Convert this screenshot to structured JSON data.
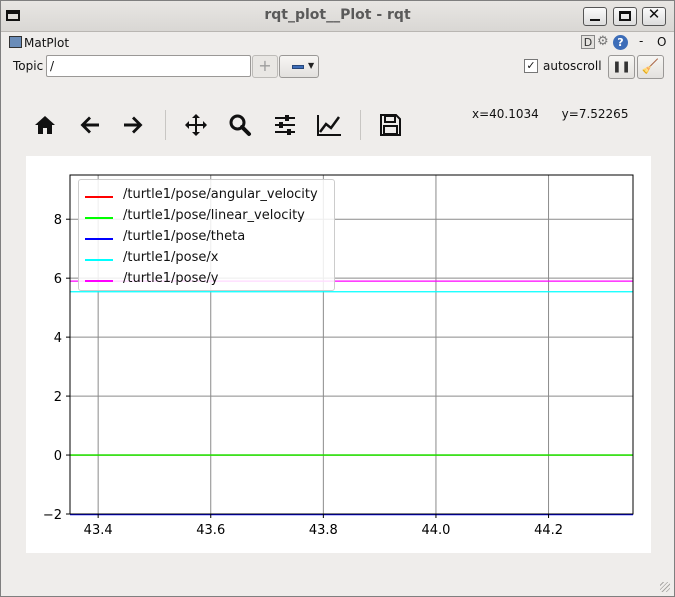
{
  "window": {
    "title": "rqt_plot__Plot - rqt"
  },
  "plugin": {
    "title": "MatPlot",
    "d_label": "D",
    "dash_label": "-",
    "o_label": "O"
  },
  "topic": {
    "label": "Topic",
    "value": "/"
  },
  "autoscroll": {
    "label": "autoscroll",
    "checked": true,
    "check_glyph": "✓"
  },
  "toolbar": {
    "tools": [
      "home-icon",
      "back-arrow-icon",
      "forward-arrow-icon",
      "pan-icon",
      "zoom-icon",
      "subplots-icon",
      "axes-line-icon",
      "save-icon"
    ]
  },
  "coords": {
    "x": "x=40.1034",
    "y": "y=7.52265"
  },
  "chart_data": {
    "type": "line",
    "x": [
      43.35,
      44.35
    ],
    "xlim": [
      43.35,
      44.35
    ],
    "ylim": [
      -2,
      9.5
    ],
    "xticks": [
      43.4,
      43.6,
      43.8,
      44.0,
      44.2
    ],
    "xtick_labels": [
      "43.4",
      "43.6",
      "43.8",
      "44.0",
      "44.2"
    ],
    "yticks": [
      -2,
      0,
      2,
      4,
      6,
      8
    ],
    "ytick_labels": [
      "−2",
      "0",
      "2",
      "4",
      "6",
      "8"
    ],
    "grid": true,
    "legend_position": "top-left",
    "series": [
      {
        "name": "/turtle1/pose/angular_velocity",
        "color": "#ff0000",
        "values": [
          0,
          0
        ]
      },
      {
        "name": "/turtle1/pose/linear_velocity",
        "color": "#00ff00",
        "values": [
          0,
          0
        ]
      },
      {
        "name": "/turtle1/pose/theta",
        "color": "#0000ff",
        "values": [
          -2.02,
          -2.02
        ]
      },
      {
        "name": "/turtle1/pose/x",
        "color": "#00ffff",
        "values": [
          5.54,
          5.54
        ]
      },
      {
        "name": "/turtle1/pose/y",
        "color": "#ff00ff",
        "values": [
          5.9,
          5.9
        ]
      }
    ]
  }
}
